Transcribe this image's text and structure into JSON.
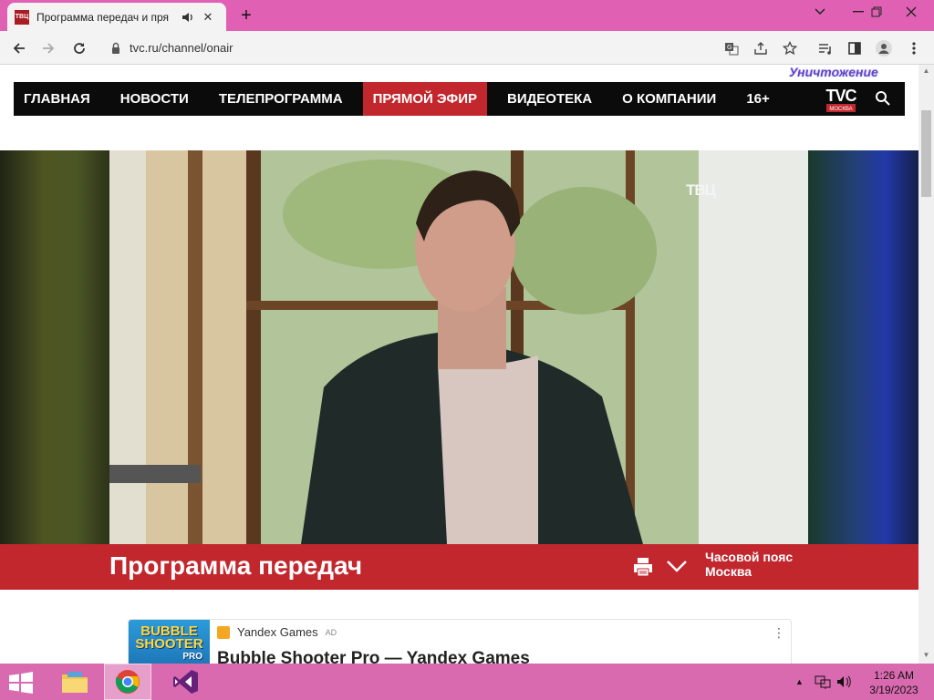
{
  "browser": {
    "tab_title": "Программа передач и пря",
    "favicon_text": "ТВЦ",
    "url": "tvc.ru/channel/onair"
  },
  "site": {
    "promo_text": "Уничтожение",
    "nav_items": [
      "ГЛАВНАЯ",
      "НОВОСТИ",
      "ТЕЛЕПРОГРАММА",
      "ПРЯМОЙ ЭФИР",
      "ВИДЕОТЕКА",
      "О КОМПАНИИ",
      "16+"
    ],
    "active_nav": "ПРЯМОЙ ЭФИР",
    "logo_text": "TVC",
    "logo_sub": "МОСКВА",
    "video_channel_mark": "ТВЦ",
    "schedule_title": "Программа передач",
    "timezone_label": "Часовой пояс",
    "timezone_value": "Москва"
  },
  "ad": {
    "image_line1": "BUBBLE",
    "image_line2": "SHOOTER",
    "image_line3": "PRO",
    "source": "Yandex Games",
    "tag": "AD",
    "headline": "Bubble Shooter Pro — Yandex Games"
  },
  "taskbar": {
    "time": "1:26 AM",
    "date": "3/19/2023"
  },
  "colors": {
    "chrome_frame": "#e061b3",
    "taskbar": "#d96ab0",
    "site_red": "#c2272d",
    "nav_black": "#0b0b0b"
  }
}
